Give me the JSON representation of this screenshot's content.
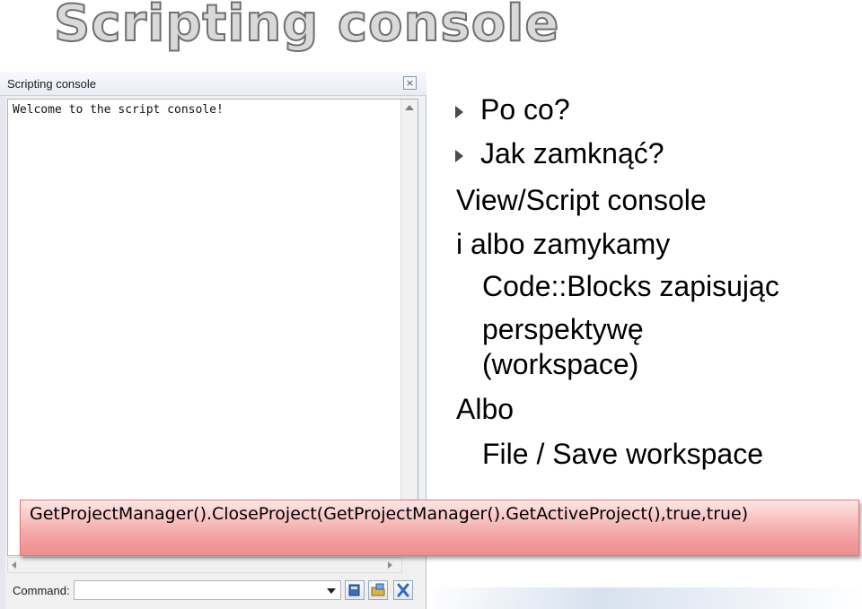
{
  "slide": {
    "title": "Scripting console"
  },
  "window": {
    "title": "Scripting console",
    "close_icon": "close-icon",
    "console_output": "Welcome to the script console!",
    "command_label": "Command:",
    "command_value": ""
  },
  "bullets": {
    "item1": "Po co?",
    "item2": "Jak zamknąć?",
    "line1": "View/Script console",
    "line2": "i albo zamykamy",
    "line3": "Code::Blocks zapisując",
    "line4": "perspektywę",
    "line5": "(workspace)",
    "line6": "Albo",
    "line7": "File / Save workspace"
  },
  "callout": {
    "text": "GetProjectManager().CloseProject(GetProjectManager().GetActiveProject(),true,true)"
  },
  "colors": {
    "callout": "#f4a7a7",
    "bullet": "#4a4a4a"
  }
}
